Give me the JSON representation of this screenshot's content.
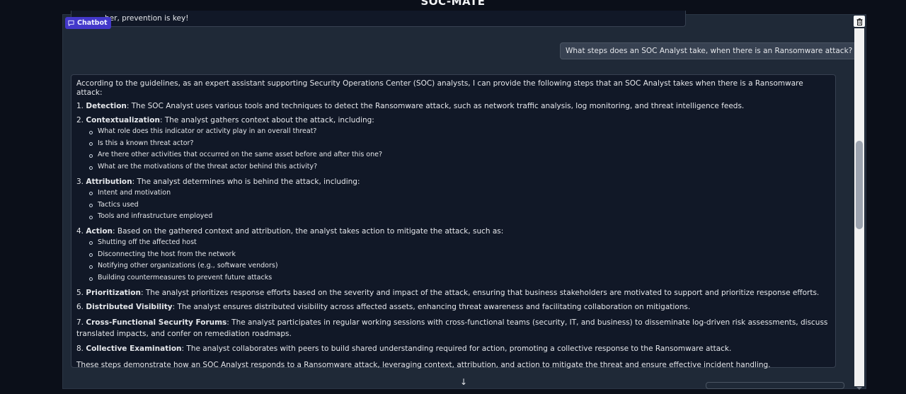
{
  "app": {
    "title": "SOC-MATE"
  },
  "chatbot": {
    "label": "Chatbot",
    "icon": "chat-icon",
    "previous_message_tail": "ber, prevention is key!",
    "user_message": "What steps does an SOC Analyst take, when there is an Ransomware attack?",
    "response": {
      "intro": "According to the guidelines, as an expert assistant supporting Security Operations Center (SOC) analysts, I can provide the following steps that an SOC Analyst takes when there is a Ransomware attack:",
      "steps": [
        {
          "num": "1.",
          "title": "Detection",
          "text": ": The SOC Analyst uses various tools and techniques to detect the Ransomware attack, such as network traffic analysis, log monitoring, and threat intelligence feeds."
        },
        {
          "num": "2.",
          "title": "Contextualization",
          "text": ": The analyst gathers context about the attack, including:",
          "items": [
            "What role does this indicator or activity play in an overall threat?",
            "Is this a known threat actor?",
            "Are there other activities that occurred on the same asset before and after this one?",
            "What are the motivations of the threat actor behind this activity?"
          ]
        },
        {
          "num": "3.",
          "title": "Attribution",
          "text": ": The analyst determines who is behind the attack, including:",
          "items": [
            "Intent and motivation",
            "Tactics used",
            "Tools and infrastructure employed"
          ]
        },
        {
          "num": "4.",
          "title": "Action",
          "text": ": Based on the gathered context and attribution, the analyst takes action to mitigate the attack, such as:",
          "items": [
            "Shutting off the affected host",
            "Disconnecting the host from the network",
            "Notifying other organizations (e.g., software vendors)",
            "Building countermeasures to prevent future attacks"
          ]
        },
        {
          "num": "5.",
          "title": "Prioritization",
          "text": ": The analyst prioritizes response efforts based on the severity and impact of the attack, ensuring that business stakeholders are motivated to support and prioritize response efforts."
        },
        {
          "num": "6.",
          "title": "Distributed Visibility",
          "text": ": The analyst ensures distributed visibility across affected assets, enhancing threat awareness and facilitating collaboration on mitigations."
        },
        {
          "num": "7.",
          "title": "Cross-Functional Security Forums",
          "text": ": The analyst participates in regular working sessions with cross-functional teams (security, IT, and business) to disseminate log-driven risk assessments, discuss translated impacts, and confer on remediation roadmaps."
        },
        {
          "num": "8.",
          "title": "Collective Examination",
          "text": ": The analyst collaborates with peers to build shared understanding required for action, promoting a collective response to the Ransomware attack."
        }
      ],
      "conclusion": "These steps demonstrate how an SOC Analyst responds to a Ransomware attack, leveraging context, attribution, and action to mitigate the threat and ensure effective incident handling."
    }
  },
  "controls": {
    "scroll_bottom_icon": "↓",
    "clear_icon": "trash-icon"
  },
  "colors": {
    "page_bg": "#0b0f19",
    "panel_bg": "#1f2937",
    "bubble_bg": "#111827",
    "user_bubble_bg": "#374151",
    "badge_bg": "#4338ca"
  }
}
